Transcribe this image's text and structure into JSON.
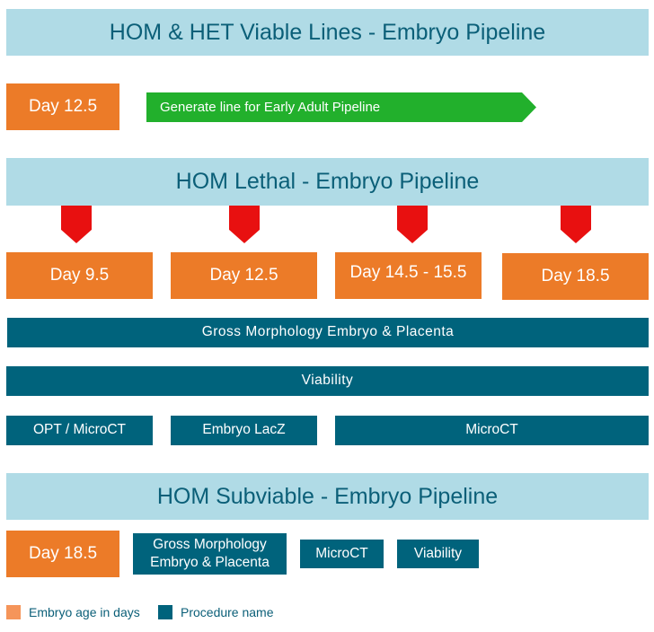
{
  "colors": {
    "banner_bg": "#b0dbe6",
    "banner_text": "#0b5f78",
    "age_box": "#ec7b28",
    "procedure_box": "#00637c",
    "generate_arrow": "#22b02c",
    "down_arrow": "#e81010",
    "legend_age_swatch": "#f5955a"
  },
  "sections": {
    "viable": {
      "title": "HOM & HET Viable Lines - Embryo Pipeline",
      "age": "Day 12.5",
      "action": "Generate line for Early Adult Pipeline"
    },
    "lethal": {
      "title": "HOM Lethal - Embryo Pipeline",
      "ages": [
        "Day 9.5",
        "Day 12.5",
        "Day 14.5 - 15.5",
        "Day 18.5"
      ],
      "procedures_full": [
        "Gross Morphology Embryo & Placenta",
        "Viability"
      ],
      "procedures_row": [
        "OPT / MicroCT",
        "Embryo LacZ",
        "MicroCT"
      ]
    },
    "subviable": {
      "title": "HOM Subviable - Embryo Pipeline",
      "age": "Day 18.5",
      "procedures": [
        "Gross Morphology",
        "Embryo & Placenta",
        "MicroCT",
        "Viability"
      ]
    }
  },
  "legend": {
    "age_label": "Embryo age in days",
    "procedure_label": "Procedure name"
  }
}
